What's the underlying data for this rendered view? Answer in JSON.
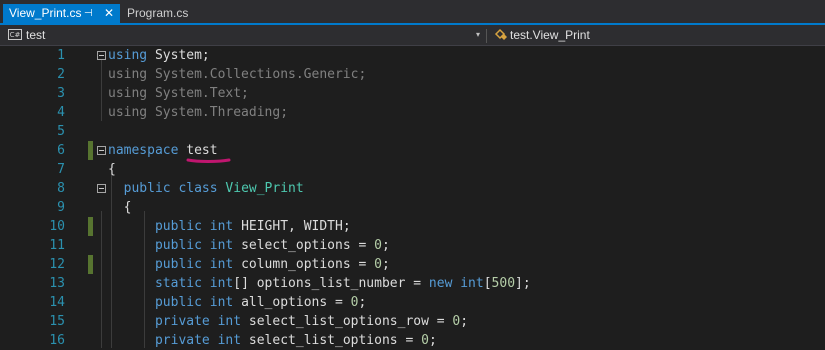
{
  "tabs": [
    {
      "label": "View_Print.cs",
      "active": true,
      "pin": "⊣",
      "close": "✕"
    },
    {
      "label": "Program.cs",
      "active": false
    }
  ],
  "nav": {
    "project": "test",
    "project_icon": "C#",
    "member": "test.View_Print",
    "arrow": "▾"
  },
  "colors": {
    "accent": "#007acc",
    "keyword": "#569cd6",
    "type": "#4ec9b0",
    "number": "#b5cea8",
    "line_number": "#2b91af",
    "change_marker": "#577430",
    "squiggle": "#c0166f"
  },
  "lines": [
    {
      "n": "1",
      "tokens": [
        [
          "kw",
          "using"
        ],
        [
          "",
          "System;"
        ]
      ]
    },
    {
      "n": "2",
      "tokens": [
        [
          "kwd",
          "using"
        ],
        [
          "kwd",
          "System.Collections.Generic;"
        ]
      ]
    },
    {
      "n": "3",
      "tokens": [
        [
          "kwd",
          "using"
        ],
        [
          "kwd",
          "System.Text;"
        ]
      ]
    },
    {
      "n": "4",
      "tokens": [
        [
          "kwd",
          "using"
        ],
        [
          "kwd",
          "System.Threading;"
        ]
      ]
    },
    {
      "n": "5",
      "tokens": []
    },
    {
      "n": "6",
      "tokens": [
        [
          "kw",
          "namespace"
        ],
        [
          "",
          "test"
        ]
      ]
    },
    {
      "n": "7",
      "tokens": [
        [
          "",
          "{"
        ]
      ]
    },
    {
      "n": "8",
      "tokens": [
        [
          "kw",
          "public"
        ],
        [
          "kw",
          "class"
        ],
        [
          "ty",
          "View_Print"
        ]
      ]
    },
    {
      "n": "9",
      "tokens": [
        [
          "",
          "{"
        ]
      ]
    },
    {
      "n": "10",
      "tokens": [
        [
          "kw",
          "public"
        ],
        [
          "kw",
          "int"
        ],
        [
          "",
          "HEIGHT, WIDTH;"
        ]
      ]
    },
    {
      "n": "11",
      "tokens": [
        [
          "kw",
          "public"
        ],
        [
          "kw",
          "int"
        ],
        [
          "",
          "select_options ="
        ],
        [
          "num",
          "0"
        ],
        [
          "",
          ";"
        ]
      ]
    },
    {
      "n": "12",
      "tokens": [
        [
          "kw",
          "public"
        ],
        [
          "kw",
          "int"
        ],
        [
          "",
          "column_options ="
        ],
        [
          "num",
          "0"
        ],
        [
          "",
          ";"
        ]
      ]
    },
    {
      "n": "13",
      "tokens": [
        [
          "kw",
          "static"
        ],
        [
          "kw",
          "int"
        ],
        [
          "",
          "[] options_list_number ="
        ],
        [
          "kw",
          "new"
        ],
        [
          "kw",
          "int"
        ],
        [
          "",
          "["
        ],
        [
          "num",
          "500"
        ],
        [
          "",
          "];"
        ]
      ]
    },
    {
      "n": "14",
      "tokens": [
        [
          "kw",
          "public"
        ],
        [
          "kw",
          "int"
        ],
        [
          "",
          "all_options ="
        ],
        [
          "num",
          "0"
        ],
        [
          "",
          ";"
        ]
      ]
    },
    {
      "n": "15",
      "tokens": [
        [
          "kw",
          "private"
        ],
        [
          "kw",
          "int"
        ],
        [
          "",
          "select_list_options_row ="
        ],
        [
          "num",
          "0"
        ],
        [
          "",
          ";"
        ]
      ]
    },
    {
      "n": "16",
      "tokens": [
        [
          "kw",
          "private"
        ],
        [
          "kw",
          "int"
        ],
        [
          "",
          "select_list_options ="
        ],
        [
          "num",
          "0"
        ],
        [
          "",
          ";"
        ]
      ]
    }
  ]
}
